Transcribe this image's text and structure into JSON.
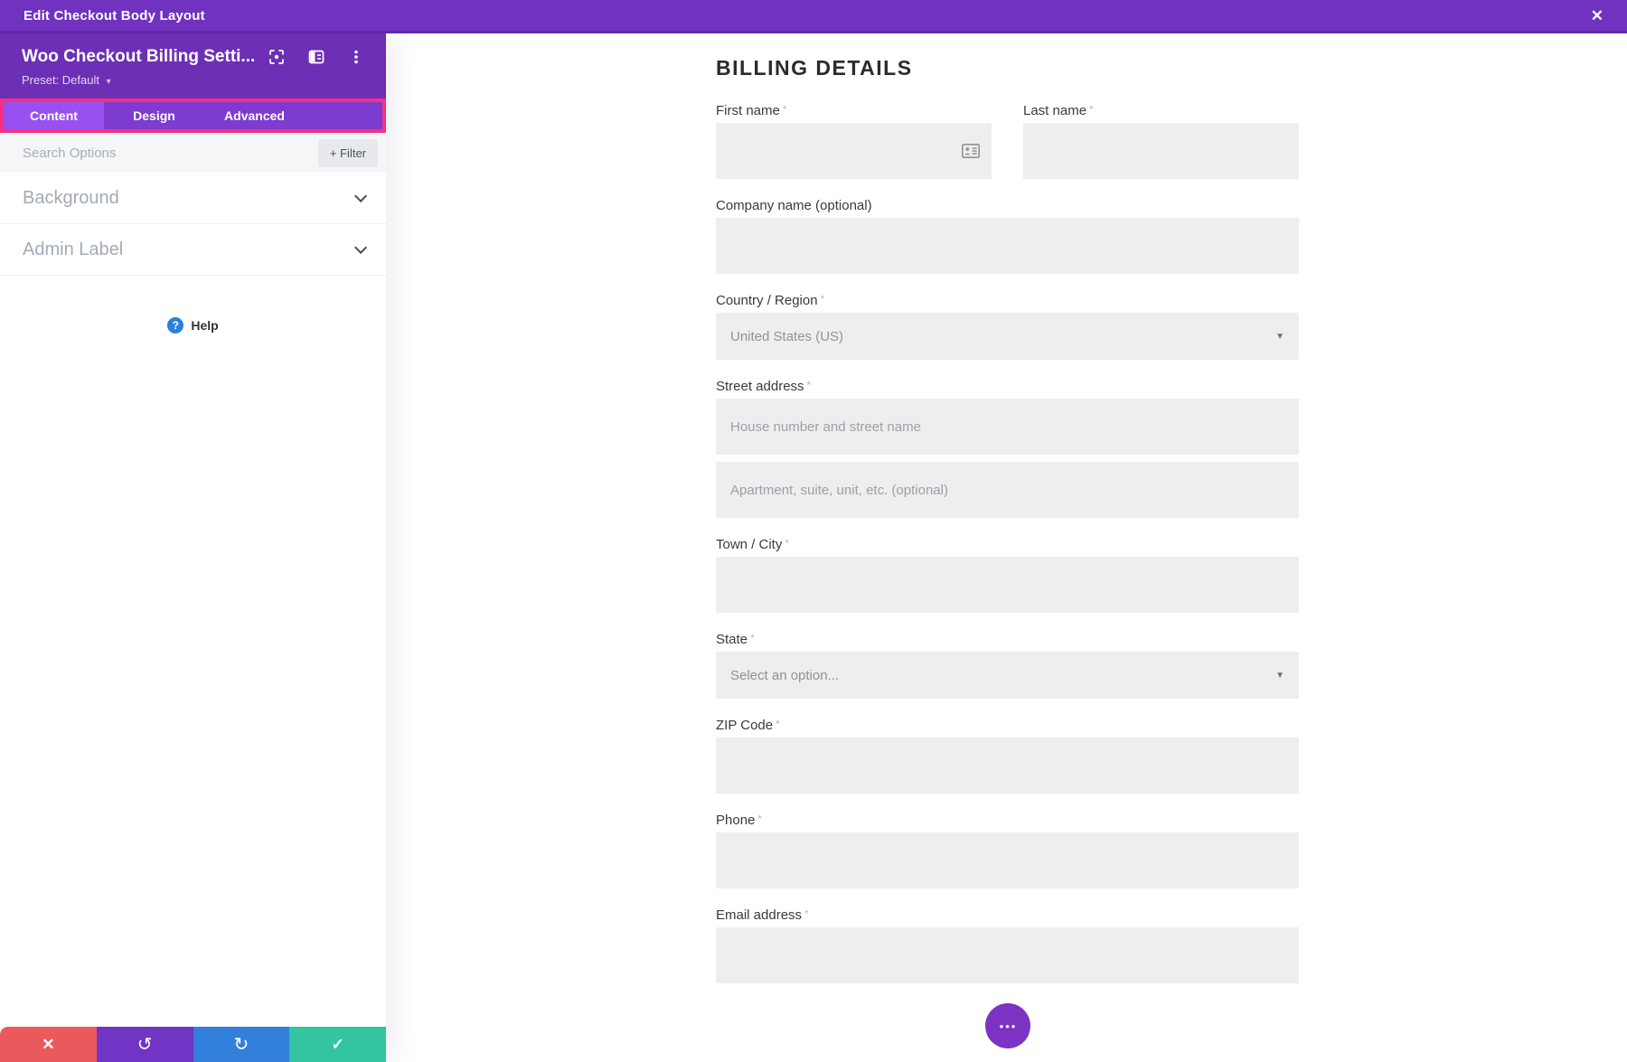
{
  "colors": {
    "topbar_purple": "#7132C0",
    "header_purple": "#6C2FB6",
    "tabbar_purple": "#7D3BD0",
    "active_tab_purple": "#9850F0",
    "highlight_pink": "#F5317F",
    "fab_purple": "#7C33C4",
    "help_blue": "#2B80DC",
    "discard_red": "#EA5A5C",
    "undo_purple": "#7134C4",
    "redo_blue": "#3380DC",
    "save_green": "#32C5A0",
    "field_gray": "#EEEEEE"
  },
  "icons": {
    "close": "✕",
    "preset_caret": "▾",
    "select_arrow": "▼",
    "help_q": "?",
    "discard": "✕",
    "undo": "↺",
    "redo": "↻",
    "save": "✓",
    "fab_dots": "•••"
  },
  "topbar": {
    "title": "Edit Checkout Body Layout"
  },
  "panel": {
    "module_title": "Woo Checkout Billing Setti...",
    "preset_label": "Preset: Default",
    "tabs": [
      {
        "label": "Content",
        "active": true
      },
      {
        "label": "Design",
        "active": false
      },
      {
        "label": "Advanced",
        "active": false
      }
    ],
    "search": {
      "placeholder": "Search Options",
      "filter_label": "+ Filter"
    },
    "sections": [
      {
        "label": "Background"
      },
      {
        "label": "Admin Label"
      }
    ],
    "help_label": "Help"
  },
  "form": {
    "title": "BILLING DETAILS",
    "fields": {
      "first_name": {
        "label": "First name",
        "required": "*",
        "value": ""
      },
      "last_name": {
        "label": "Last name",
        "required": "*",
        "value": ""
      },
      "company": {
        "label": "Company name (optional)",
        "required": "",
        "value": ""
      },
      "country": {
        "label": "Country / Region",
        "required": "*",
        "value": "United States (US)"
      },
      "street": {
        "label": "Street address",
        "required": "*",
        "placeholder1": "House number and street name",
        "placeholder2": "Apartment, suite, unit, etc. (optional)"
      },
      "city": {
        "label": "Town / City",
        "required": "*",
        "value": ""
      },
      "state": {
        "label": "State",
        "required": "*",
        "value": "Select an option..."
      },
      "zip": {
        "label": "ZIP Code",
        "required": "*",
        "value": ""
      },
      "phone": {
        "label": "Phone",
        "required": "*",
        "value": ""
      },
      "email": {
        "label": "Email address",
        "required": "*",
        "value": ""
      }
    }
  }
}
